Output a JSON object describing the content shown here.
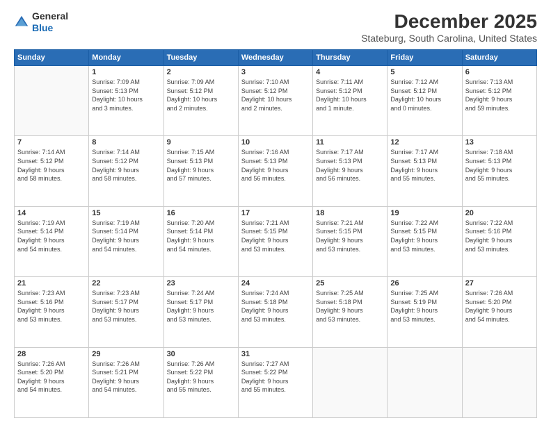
{
  "logo": {
    "general": "General",
    "blue": "Blue"
  },
  "header": {
    "month": "December 2025",
    "location": "Stateburg, South Carolina, United States"
  },
  "weekdays": [
    "Sunday",
    "Monday",
    "Tuesday",
    "Wednesday",
    "Thursday",
    "Friday",
    "Saturday"
  ],
  "weeks": [
    [
      {
        "day": "",
        "info": ""
      },
      {
        "day": "1",
        "info": "Sunrise: 7:09 AM\nSunset: 5:13 PM\nDaylight: 10 hours\nand 3 minutes."
      },
      {
        "day": "2",
        "info": "Sunrise: 7:09 AM\nSunset: 5:12 PM\nDaylight: 10 hours\nand 2 minutes."
      },
      {
        "day": "3",
        "info": "Sunrise: 7:10 AM\nSunset: 5:12 PM\nDaylight: 10 hours\nand 2 minutes."
      },
      {
        "day": "4",
        "info": "Sunrise: 7:11 AM\nSunset: 5:12 PM\nDaylight: 10 hours\nand 1 minute."
      },
      {
        "day": "5",
        "info": "Sunrise: 7:12 AM\nSunset: 5:12 PM\nDaylight: 10 hours\nand 0 minutes."
      },
      {
        "day": "6",
        "info": "Sunrise: 7:13 AM\nSunset: 5:12 PM\nDaylight: 9 hours\nand 59 minutes."
      }
    ],
    [
      {
        "day": "7",
        "info": "Sunrise: 7:14 AM\nSunset: 5:12 PM\nDaylight: 9 hours\nand 58 minutes."
      },
      {
        "day": "8",
        "info": "Sunrise: 7:14 AM\nSunset: 5:12 PM\nDaylight: 9 hours\nand 58 minutes."
      },
      {
        "day": "9",
        "info": "Sunrise: 7:15 AM\nSunset: 5:13 PM\nDaylight: 9 hours\nand 57 minutes."
      },
      {
        "day": "10",
        "info": "Sunrise: 7:16 AM\nSunset: 5:13 PM\nDaylight: 9 hours\nand 56 minutes."
      },
      {
        "day": "11",
        "info": "Sunrise: 7:17 AM\nSunset: 5:13 PM\nDaylight: 9 hours\nand 56 minutes."
      },
      {
        "day": "12",
        "info": "Sunrise: 7:17 AM\nSunset: 5:13 PM\nDaylight: 9 hours\nand 55 minutes."
      },
      {
        "day": "13",
        "info": "Sunrise: 7:18 AM\nSunset: 5:13 PM\nDaylight: 9 hours\nand 55 minutes."
      }
    ],
    [
      {
        "day": "14",
        "info": "Sunrise: 7:19 AM\nSunset: 5:14 PM\nDaylight: 9 hours\nand 54 minutes."
      },
      {
        "day": "15",
        "info": "Sunrise: 7:19 AM\nSunset: 5:14 PM\nDaylight: 9 hours\nand 54 minutes."
      },
      {
        "day": "16",
        "info": "Sunrise: 7:20 AM\nSunset: 5:14 PM\nDaylight: 9 hours\nand 54 minutes."
      },
      {
        "day": "17",
        "info": "Sunrise: 7:21 AM\nSunset: 5:15 PM\nDaylight: 9 hours\nand 53 minutes."
      },
      {
        "day": "18",
        "info": "Sunrise: 7:21 AM\nSunset: 5:15 PM\nDaylight: 9 hours\nand 53 minutes."
      },
      {
        "day": "19",
        "info": "Sunrise: 7:22 AM\nSunset: 5:15 PM\nDaylight: 9 hours\nand 53 minutes."
      },
      {
        "day": "20",
        "info": "Sunrise: 7:22 AM\nSunset: 5:16 PM\nDaylight: 9 hours\nand 53 minutes."
      }
    ],
    [
      {
        "day": "21",
        "info": "Sunrise: 7:23 AM\nSunset: 5:16 PM\nDaylight: 9 hours\nand 53 minutes."
      },
      {
        "day": "22",
        "info": "Sunrise: 7:23 AM\nSunset: 5:17 PM\nDaylight: 9 hours\nand 53 minutes."
      },
      {
        "day": "23",
        "info": "Sunrise: 7:24 AM\nSunset: 5:17 PM\nDaylight: 9 hours\nand 53 minutes."
      },
      {
        "day": "24",
        "info": "Sunrise: 7:24 AM\nSunset: 5:18 PM\nDaylight: 9 hours\nand 53 minutes."
      },
      {
        "day": "25",
        "info": "Sunrise: 7:25 AM\nSunset: 5:18 PM\nDaylight: 9 hours\nand 53 minutes."
      },
      {
        "day": "26",
        "info": "Sunrise: 7:25 AM\nSunset: 5:19 PM\nDaylight: 9 hours\nand 53 minutes."
      },
      {
        "day": "27",
        "info": "Sunrise: 7:26 AM\nSunset: 5:20 PM\nDaylight: 9 hours\nand 54 minutes."
      }
    ],
    [
      {
        "day": "28",
        "info": "Sunrise: 7:26 AM\nSunset: 5:20 PM\nDaylight: 9 hours\nand 54 minutes."
      },
      {
        "day": "29",
        "info": "Sunrise: 7:26 AM\nSunset: 5:21 PM\nDaylight: 9 hours\nand 54 minutes."
      },
      {
        "day": "30",
        "info": "Sunrise: 7:26 AM\nSunset: 5:22 PM\nDaylight: 9 hours\nand 55 minutes."
      },
      {
        "day": "31",
        "info": "Sunrise: 7:27 AM\nSunset: 5:22 PM\nDaylight: 9 hours\nand 55 minutes."
      },
      {
        "day": "",
        "info": ""
      },
      {
        "day": "",
        "info": ""
      },
      {
        "day": "",
        "info": ""
      }
    ]
  ]
}
